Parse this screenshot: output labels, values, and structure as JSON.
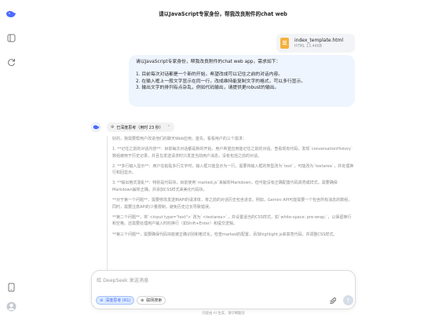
{
  "app": {
    "title": "请以JavaScript专家身份，帮我改良附件的chat web"
  },
  "sidebar": {
    "icons": [
      "logo-whale-icon",
      "toggle-sidebar-icon",
      "new-chat-icon",
      "phone-icon",
      "user-avatar-icon"
    ]
  },
  "attachment": {
    "name": "index_template.html",
    "size": "HTML 13.44KB"
  },
  "user_message": {
    "lines": [
      "请以JavaScript专家身份，帮我改良附件的chat web app，需求如下：",
      "1. 目前每次对话都是一个新的开始，希望改成可以记住之前的对话内容。",
      "2. 在输入框上一般文字显示在同一行，改成维持能复制文字的格式，可以多行显示。",
      "3. 输出文字的排列有点杂乱，例如代码输出，请提供更robust的输出。"
    ]
  },
  "assistant": {
    "thinking_label": "已深度思考（用时 23 秒）",
    "paragraphs": [
      "好的，我需要帮用户改进他们的聊天Web应用。首先，看看用户的三个需求：",
      "1. **记住之前的对话内容**：目前每次对话都是新的开始，用户希望应用能记住之前的对话。查看现有代码，发现`conversationHistory`数组被用于历史记录，并且在发送请求时只发送当前用户消息，没有包括之前的对话。",
      "2. **多行输入显示**：用户在粘贴多行文字时，输入框只能显示为一行，需要将输入框的类型改为`text`，可能改为`textarea`，并处理换行和回显示。",
      "3. **输出格式混乱**：特别是代码块，目前使用`marked.js`来解析Markdown，但可能没有正确配置代码高亮或样式，需要确保Markdown解析正确，并添加CSS样式来美化代码块。",
      "**对于第一个问题**，需要修改发送到API的请求体，将之前的对话历史包含进去。例如，Gemini API可能需要一个包含所有消息的数组，同时，需要注意API的少量限制，避免历史过长导致错误。",
      "**第二个问题**，将`<input type=\"text\">`改为`<textarea>`，并设置适当的CSS样式，如`white-space: pre-wrap;`，以保留换行和空格。还需要处理用户输入时的换行（如Shift+Enter）和提交逻辑。",
      "**第三个问题**，需要确保代码块能被正确识别和格式化，检查marked的配置，添加highlight.js来高亮代码，并调整CSS样式。"
    ]
  },
  "composer": {
    "placeholder": "给 DeepSeek 发送消息",
    "deepthink_label": "深度思考 (R1)",
    "websearch_label": "联网搜索"
  },
  "footer": {
    "text": "内容由 AI 生成，请仔细甄别"
  },
  "colors": {
    "accent": "#4d6bfe",
    "user_bubble": "#eff5fe"
  }
}
